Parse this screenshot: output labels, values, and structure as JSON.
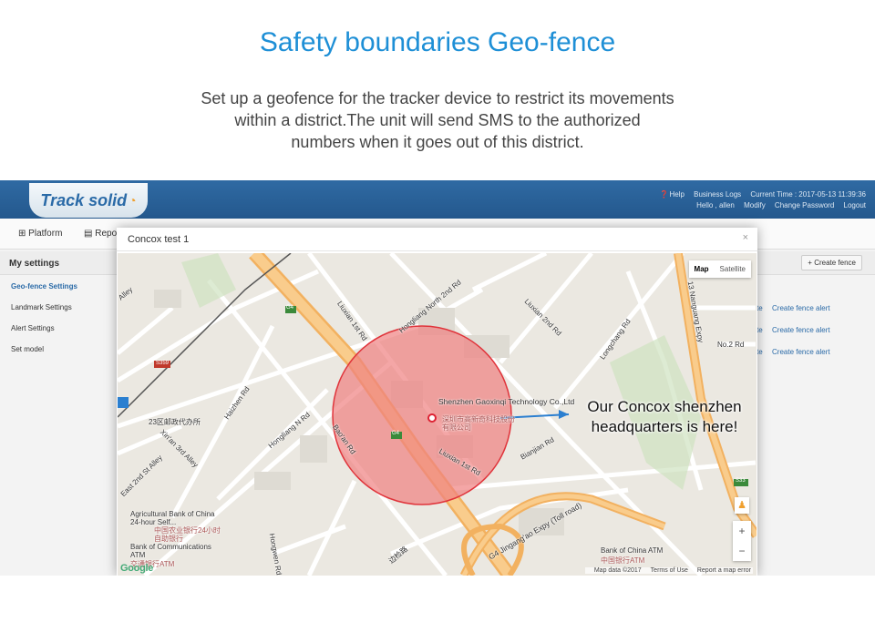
{
  "hero": {
    "title": "Safety boundaries Geo-fence",
    "desc_line1": "Set up a geofence for the tracker device to restrict its movements",
    "desc_line2": "within a district.The unit will send SMS to the authorized",
    "desc_line3": "numbers when it goes out of this district."
  },
  "app": {
    "logo": "Track solid",
    "help": "Help",
    "business_logs": "Business Logs",
    "current_time": "Current Time : 2017-05-13 11:39:36",
    "hello": "Hello , allen",
    "modify": "Modify",
    "change_password": "Change Password",
    "logout": "Logout"
  },
  "nav": {
    "platform": "Platform",
    "report": "Repo"
  },
  "settings": {
    "title": "My settings",
    "create_fence": "+ Create fence",
    "menu": [
      "Geo-fence Settings",
      "Landmark Settings",
      "Alert Settings",
      "Set model"
    ],
    "alert_link": "Create fence alert"
  },
  "modal": {
    "title": "Concox test 1",
    "close": "×"
  },
  "map": {
    "map_btn": "Map",
    "satellite_btn": "Satellite",
    "zoom_in": "+",
    "zoom_out": "−",
    "map_data": "Map data ©2017",
    "terms": "Terms of Use",
    "report": "Report a map error",
    "google": "Google",
    "labels": {
      "place_name": "Shenzhen Gaoxinqi Technology Co.,Ltd",
      "place_cn": "深圳市高新奇科技股份有限公司",
      "liuxian1": "Liuxian 1st Rd",
      "hongliang_north2": "Hongliang North 2nd Rd",
      "liuxian2": "Liuxian 2nd Rd",
      "longchang": "Longchang Rd",
      "nanguang": "13 Nanguang Expy",
      "no2": "No.2 Rd",
      "haizhen": "Haizhen Rd",
      "hongliang_n": "Hongliang N Rd",
      "baoan": "Bao'an Rd",
      "xinan": "Xin'an 3rd Alley",
      "east2": "East 2nd St Alley",
      "post": "23区邮政代办所",
      "liuxian1_low": "Liuxian 1st Rd",
      "bianjian": "Bianjian Rd",
      "g4": "G4 Jingang'ao Expy (Toll road)",
      "agri": "Agricultural Bank of China 24-hour Self...",
      "agri_cn": "中国农业银行24小时自助银行",
      "bocom": "Bank of Communications ATM",
      "bocom_cn": "交通银行ATM",
      "boc": "Bank of China ATM",
      "boc_cn": "中国银行ATM",
      "biangui": "边检路",
      "hongwen": "Hongwen Rd",
      "alley": "Alley",
      "s359": "S359",
      "g4_shield": "G4",
      "s33": "S33"
    }
  },
  "callout": {
    "line1": "Our Concox shenzhen",
    "line2": "headquarters is here!"
  },
  "colors": {
    "title_blue": "#1e8fd6",
    "fence_fill": "#f08080",
    "fence_stroke": "#e0343b",
    "highway": "#f5b86b"
  }
}
